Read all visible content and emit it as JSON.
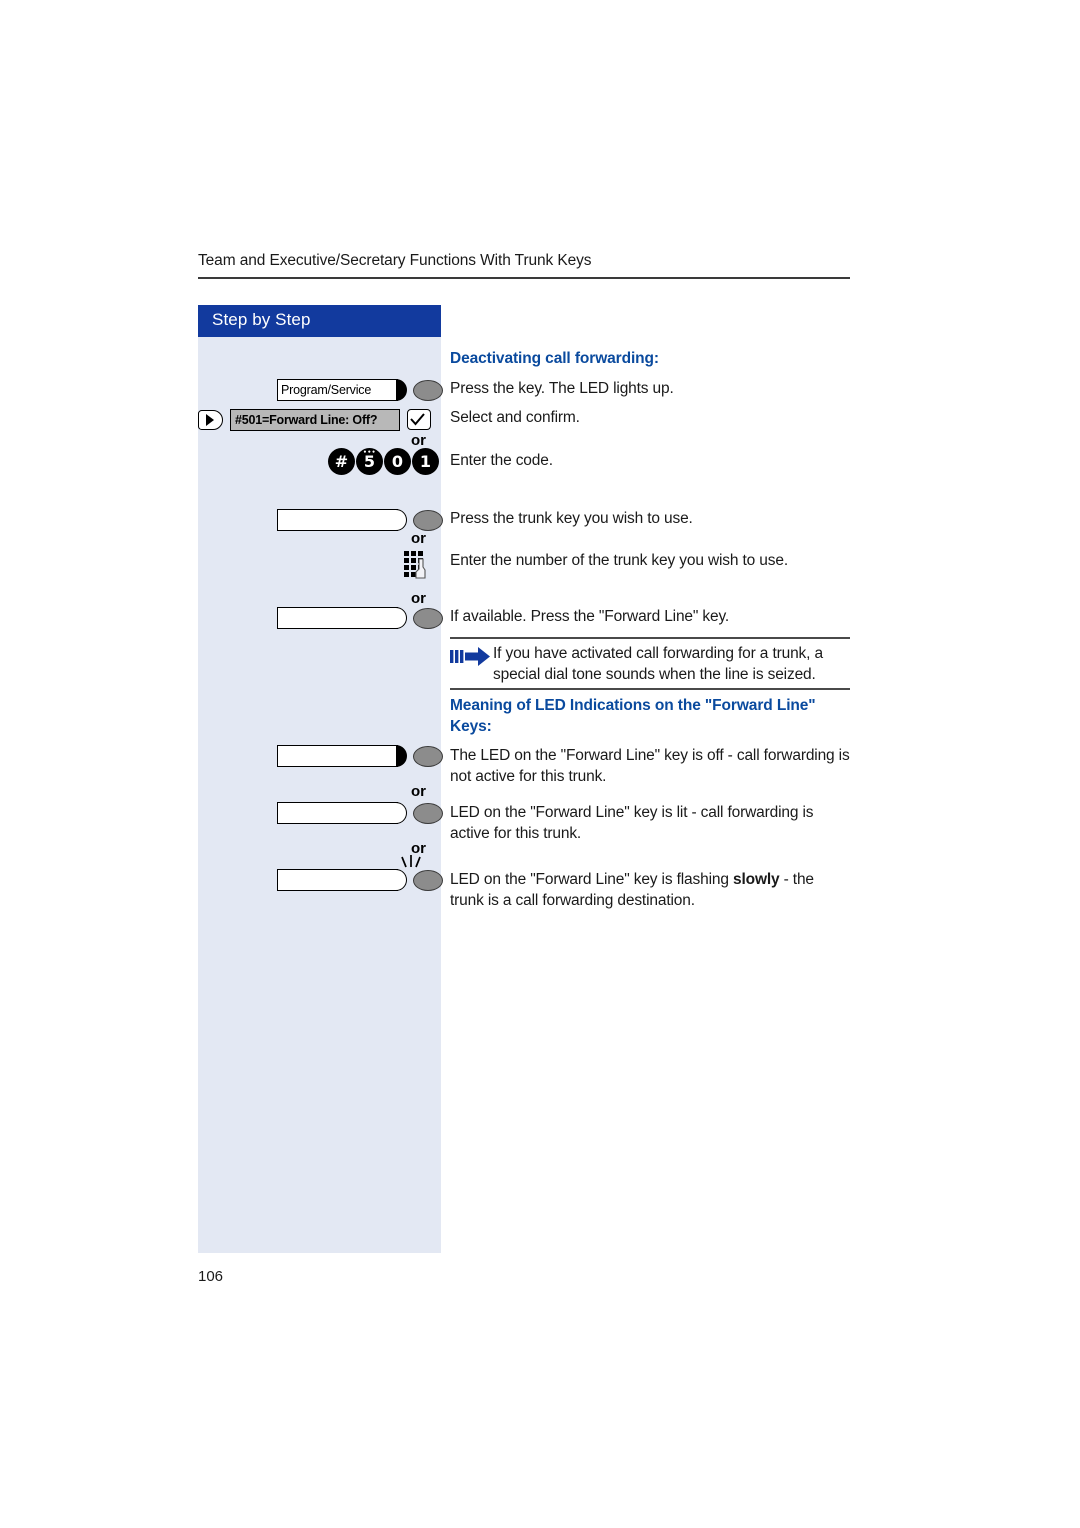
{
  "document": {
    "running_header": "Team and Executive/Secretary Functions With Trunk Keys",
    "page_number": "106",
    "accent_color": "#0a4a9e",
    "banner_color": "#123a9e",
    "sidebar_color": "#e3e8f3"
  },
  "sidebar": {
    "banner_label": "Step by Step",
    "keys": [
      {
        "name": "program-service-key",
        "label": "Program/Service",
        "led_state": "solid",
        "icon": "phone-key-with-led"
      },
      {
        "name": "display-line",
        "label": "#501=Forward Line: Off?",
        "rocker_icon": "scroll-rocker-icon",
        "confirm_icon": "checkmark-icon"
      },
      {
        "name": "dialpad-code",
        "digits": [
          "#",
          "5",
          "0",
          "1"
        ]
      },
      {
        "name": "trunk-key",
        "label": "",
        "led_state": "hollow",
        "icon": "phone-key-with-led"
      },
      {
        "name": "keypad-entry",
        "icon": "keypad-hand-icon"
      },
      {
        "name": "forward-line-key",
        "label": "",
        "led_state": "hollow",
        "icon": "phone-key-with-led"
      },
      {
        "name": "led-off-key",
        "label": "",
        "led_state": "solid",
        "icon": "phone-key-with-led"
      },
      {
        "name": "led-lit-key",
        "label": "",
        "led_state": "hollow",
        "icon": "phone-key-with-led"
      },
      {
        "name": "led-flashing-key",
        "label": "",
        "led_state": "flashing",
        "icon": "phone-key-with-led-flashing"
      }
    ],
    "or_label": "or"
  },
  "main": {
    "section_title_1": "Deactivating call forwarding:",
    "step_1": "Press the key. The LED lights up.",
    "step_2": "Select and confirm.",
    "step_3": "Enter the code.",
    "step_4": "Press the trunk key you wish to use.",
    "step_5": "Enter the number of the trunk key you wish to use.",
    "step_6": "If available. Press the \"Forward Line\" key.",
    "note": {
      "icon": "note-arrow-icon",
      "text": "If you have activated call forwarding for a trunk, a special dial tone sounds when the line is seized."
    },
    "section_title_2": "Meaning of LED Indications on the \"Forward Line\" Keys:",
    "led_meaning_1": "The LED on the \"Forward Line\" key is off - call forwarding is not active for this trunk.",
    "led_meaning_2": "LED on the \"Forward Line\" key is lit - call forwarding is active for this trunk.",
    "led_meaning_3_pre": "LED on the \"Forward Line\" key is flashing ",
    "led_meaning_3_bold": "slowly",
    "led_meaning_3_post": " - the trunk is a call forwarding destination."
  }
}
